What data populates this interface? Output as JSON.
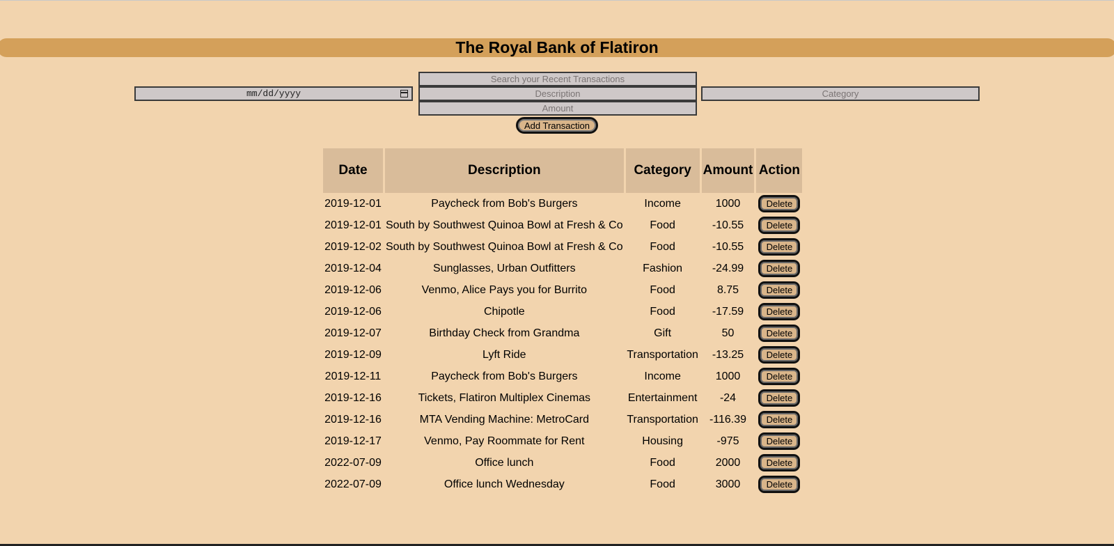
{
  "header": {
    "title": "The Royal Bank of Flatiron"
  },
  "search": {
    "placeholder": "Search your Recent Transactions"
  },
  "form": {
    "date_format": "mm/dd/yyyy",
    "description_placeholder": "Description",
    "category_placeholder": "Category",
    "amount_placeholder": "Amount",
    "submit_label": "Add Transaction"
  },
  "table": {
    "headers": [
      "Date",
      "Description",
      "Category",
      "Amount",
      "Action"
    ],
    "action_label": "Delete",
    "rows": [
      {
        "date": "2019-12-01",
        "description": "Paycheck from Bob's Burgers",
        "category": "Income",
        "amount": "1000"
      },
      {
        "date": "2019-12-01",
        "description": "South by Southwest Quinoa Bowl at Fresh & Co",
        "category": "Food",
        "amount": "-10.55"
      },
      {
        "date": "2019-12-02",
        "description": "South by Southwest Quinoa Bowl at Fresh & Co",
        "category": "Food",
        "amount": "-10.55"
      },
      {
        "date": "2019-12-04",
        "description": "Sunglasses, Urban Outfitters",
        "category": "Fashion",
        "amount": "-24.99"
      },
      {
        "date": "2019-12-06",
        "description": "Venmo, Alice Pays you for Burrito",
        "category": "Food",
        "amount": "8.75"
      },
      {
        "date": "2019-12-06",
        "description": "Chipotle",
        "category": "Food",
        "amount": "-17.59"
      },
      {
        "date": "2019-12-07",
        "description": "Birthday Check from Grandma",
        "category": "Gift",
        "amount": "50"
      },
      {
        "date": "2019-12-09",
        "description": "Lyft Ride",
        "category": "Transportation",
        "amount": "-13.25"
      },
      {
        "date": "2019-12-11",
        "description": "Paycheck from Bob's Burgers",
        "category": "Income",
        "amount": "1000"
      },
      {
        "date": "2019-12-16",
        "description": "Tickets, Flatiron Multiplex Cinemas",
        "category": "Entertainment",
        "amount": "-24"
      },
      {
        "date": "2019-12-16",
        "description": "MTA Vending Machine: MetroCard",
        "category": "Transportation",
        "amount": "-116.39"
      },
      {
        "date": "2019-12-17",
        "description": "Venmo, Pay Roommate for Rent",
        "category": "Housing",
        "amount": "-975"
      },
      {
        "date": "2022-07-09",
        "description": "Office lunch",
        "category": "Food",
        "amount": "2000"
      },
      {
        "date": "2022-07-09",
        "description": "Office lunch Wednesday",
        "category": "Food",
        "amount": "3000"
      }
    ]
  }
}
